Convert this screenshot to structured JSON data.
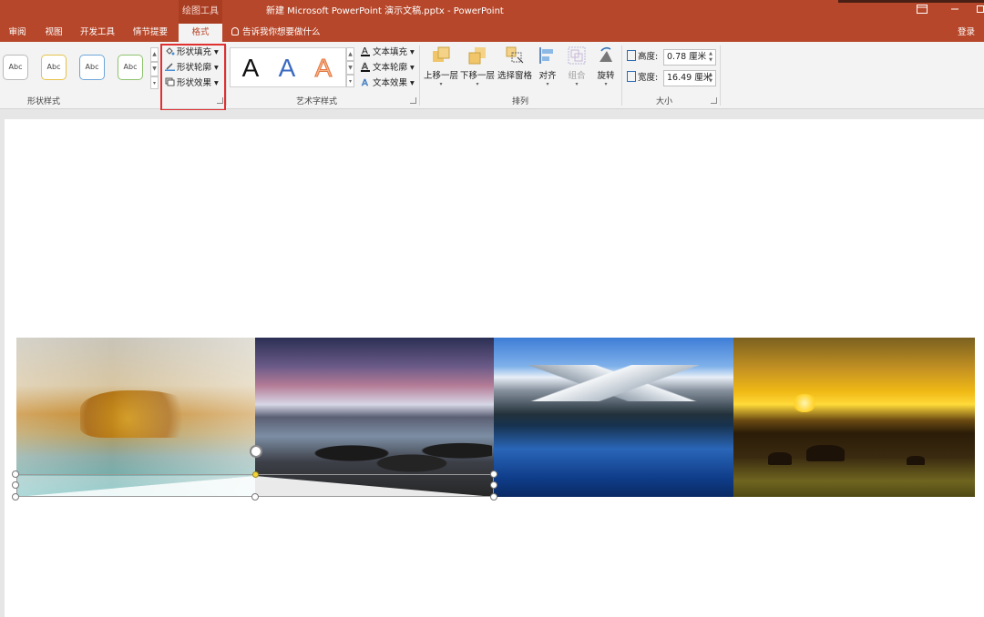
{
  "titlebar": {
    "context_tab": "绘图工具",
    "title": "新建 Microsoft PowerPoint 演示文稿.pptx - PowerPoint",
    "window_controls": [
      "restore-ribbon-icon",
      "minimize-icon",
      "maximize-icon"
    ]
  },
  "tabs": {
    "review": "审阅",
    "view": "视图",
    "developer": "开发工具",
    "storyboard": "情节提要",
    "format": "格式",
    "tell_me": "告诉我你想要做什么",
    "login": "登录"
  },
  "ribbon": {
    "shape_styles": {
      "label": "形状样式",
      "items": [
        "Abc",
        "Abc",
        "Abc",
        "Abc"
      ],
      "border_colors": [
        "#b9b9b9",
        "#e6c24a",
        "#6ea6d8",
        "#8cc26c"
      ]
    },
    "shape_format": {
      "fill": "形状填充",
      "outline": "形状轮廓",
      "effects": "形状效果"
    },
    "wordart": {
      "label": "艺术字样式",
      "letters": [
        "A",
        "A",
        "A"
      ],
      "text_fill": "文本填充",
      "text_outline": "文本轮廓",
      "text_effects": "文本效果"
    },
    "arrange": {
      "label": "排列",
      "bring_forward": "上移一层",
      "send_backward": "下移一层",
      "selection_pane": "选择窗格",
      "align": "对齐",
      "group": "组合",
      "rotate": "旋转"
    },
    "size": {
      "label": "大小",
      "height_label": "高度:",
      "height_value": "0.78 厘米",
      "width_label": "宽度:",
      "width_value": "16.49 厘米"
    }
  },
  "colors": {
    "accent": "#b7472a",
    "highlight": "#e03030"
  }
}
